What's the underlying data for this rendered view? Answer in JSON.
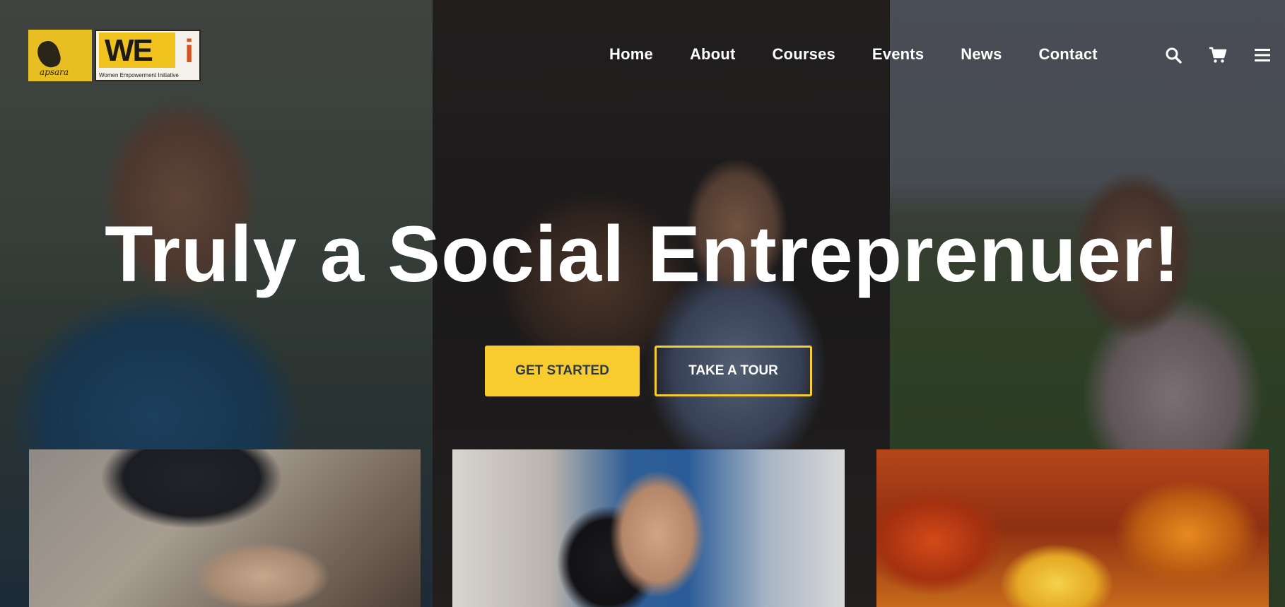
{
  "brand": {
    "apsara_text": "apsara",
    "wei_text": "WE",
    "wei_i": "i",
    "wei_subtitle": "Women Empowerment Initiative"
  },
  "nav": {
    "items": [
      {
        "label": "Home"
      },
      {
        "label": "About"
      },
      {
        "label": "Courses"
      },
      {
        "label": "Events"
      },
      {
        "label": "News"
      },
      {
        "label": "Contact"
      }
    ],
    "icons": [
      "search-icon",
      "cart-icon",
      "menu-icon"
    ]
  },
  "hero": {
    "headline": "Truly a Social Entreprenuer!",
    "primary_button": "GET STARTED",
    "secondary_button": "TAKE A TOUR"
  },
  "colors": {
    "accent": "#f8cb2e",
    "button_text_dark": "#2c3a4d",
    "text_light": "#ffffff"
  }
}
